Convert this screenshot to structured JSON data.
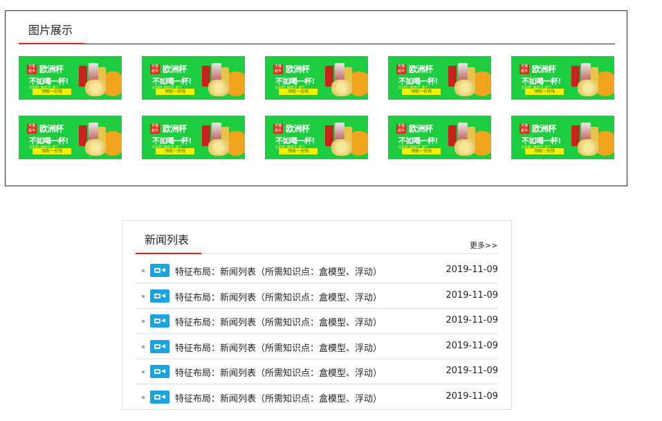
{
  "gallery": {
    "title": "图片展示",
    "ad": {
      "logo": "天猫超市",
      "line1": "欧洲杯",
      "line2": "不如喝一杯!",
      "line3": "比利时 西班牙 波兰",
      "button": "领取一份钱"
    },
    "accent_color": "#e0201a",
    "banner_color": "#1ccd3f"
  },
  "news": {
    "title": "新闻列表",
    "more": "更多>>",
    "items": [
      {
        "text": "特征布局：新闻列表（所需知识点：盒模型、浮动）",
        "date": "2019-11-09"
      },
      {
        "text": "特征布局：新闻列表（所需知识点：盒模型、浮动）",
        "date": "2019-11-09"
      },
      {
        "text": "特征布局：新闻列表（所需知识点：盒模型、浮动）",
        "date": "2019-11-09"
      },
      {
        "text": "特征布局：新闻列表（所需知识点：盒模型、浮动）",
        "date": "2019-11-09"
      },
      {
        "text": "特征布局：新闻列表（所需知识点：盒模型、浮动）",
        "date": "2019-11-09"
      },
      {
        "text": "特征布局：新闻列表（所需知识点：盒模型、浮动）",
        "date": "2019-11-09"
      }
    ],
    "icon": "video-camera-icon"
  }
}
